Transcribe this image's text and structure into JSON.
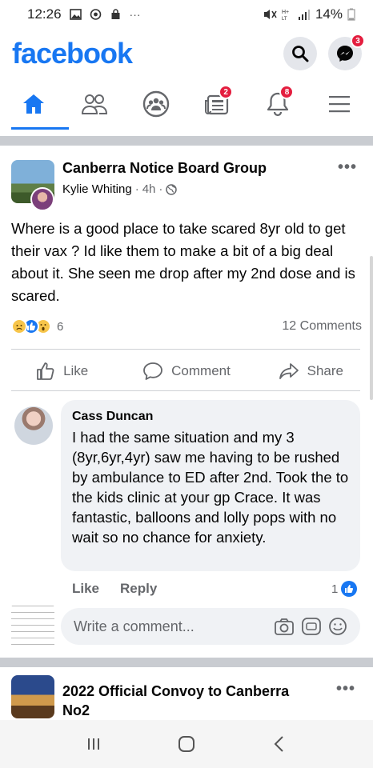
{
  "status_bar": {
    "time": "12:26",
    "dots": "···",
    "battery": "14%"
  },
  "header": {
    "logo": "facebook",
    "messenger_badge": "3"
  },
  "nav": {
    "friends_badge": "",
    "news_badge": "2",
    "notifications_badge": "8"
  },
  "post": {
    "group_name": "Canberra Notice Board Group",
    "author": "Kylie Whiting",
    "time": "4h",
    "text": "Where is a good place to take scared 8yr old to get their vax ? Id like them to make a bit of a big deal about it. She seen me drop after my 2nd dose and is scared.",
    "reaction_count": "6",
    "comments_count": "12 Comments",
    "actions": {
      "like": "Like",
      "comment": "Comment",
      "share": "Share"
    }
  },
  "comment": {
    "name": "Cass Duncan",
    "text": "I had the same situation and my 3 (8yr,6yr,4yr) saw me having to be rushed by ambulance to ED after 2nd. Took the to the kids clinic at your gp Crace. It was fantastic, balloons and lolly pops with no wait so no chance for anxiety.",
    "like": "Like",
    "reply": "Reply",
    "like_count": "1"
  },
  "write_comment": {
    "placeholder": "Write a comment..."
  },
  "post2": {
    "title": "2022 Official Convoy to Canberra No2"
  },
  "colors": {
    "brand": "#1877f2",
    "badge": "#e41e3f",
    "secondary_text": "#65676b",
    "bubble": "#f0f2f5"
  }
}
